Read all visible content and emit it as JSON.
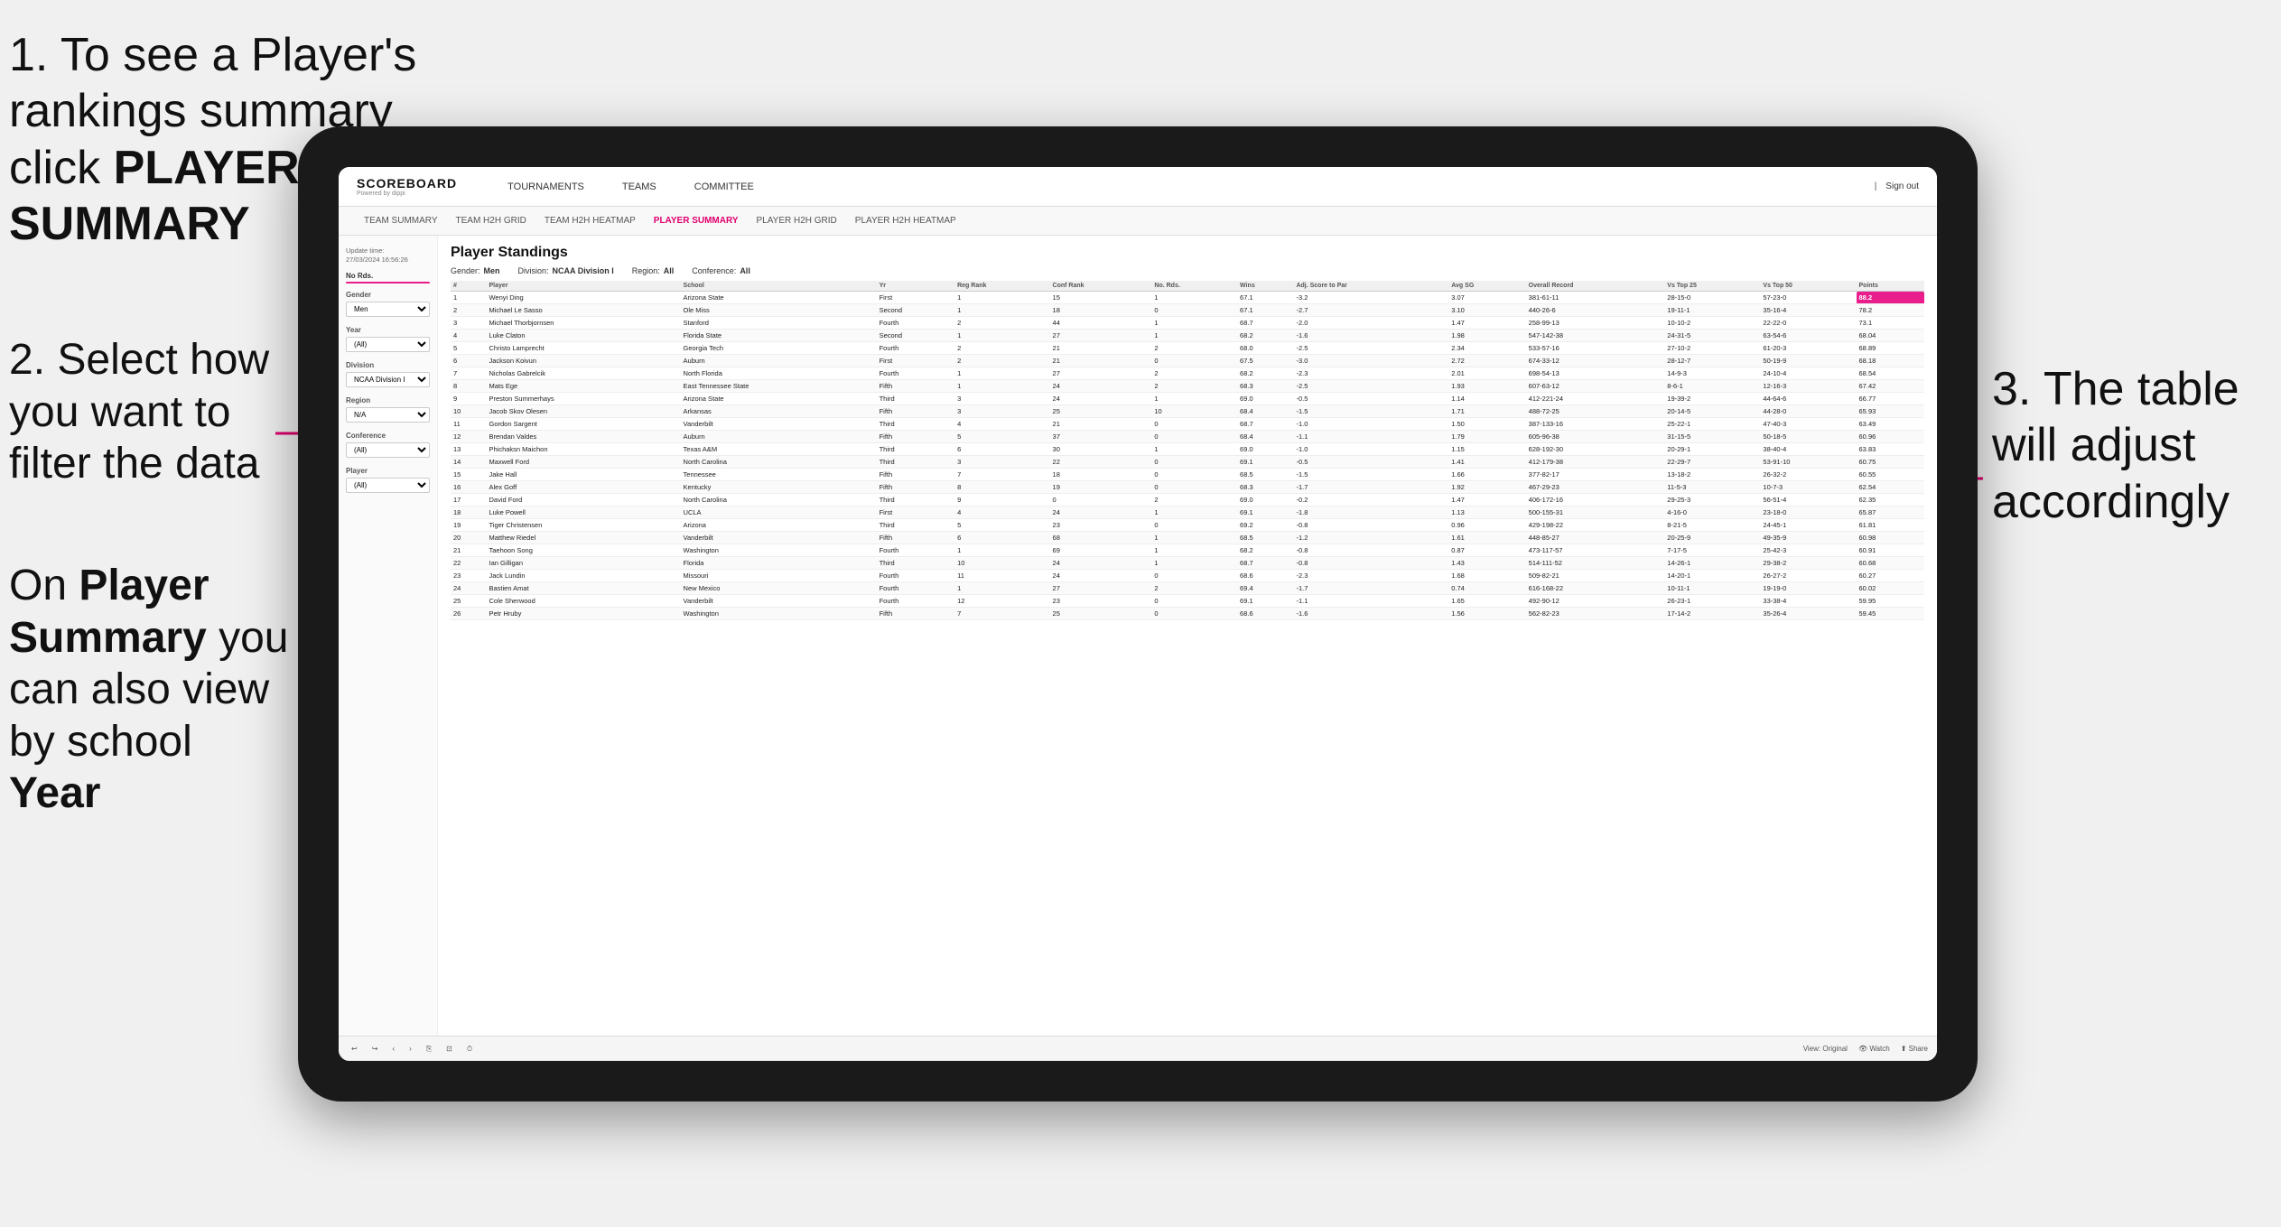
{
  "instructions": {
    "step1": "1. To see a Player's rankings summary click ",
    "step1_bold": "PLAYER SUMMARY",
    "step2_title": "2. Select how you want to filter the data",
    "step3_bottom": "On ",
    "step3_bold1": "Player Summary",
    "step3_mid": " you can also view by school ",
    "step3_bold2": "Year",
    "step3_right": "3. The table will adjust accordingly"
  },
  "nav": {
    "logo": "SCOREBOARD",
    "logo_sub": "Powered by dippi",
    "links": [
      "TOURNAMENTS",
      "TEAMS",
      "COMMITTEE"
    ],
    "sign_in": "Sign out"
  },
  "subnav": {
    "links": [
      "TEAM SUMMARY",
      "TEAM H2H GRID",
      "TEAM H2H HEATMAP",
      "PLAYER SUMMARY",
      "PLAYER H2H GRID",
      "PLAYER H2H HEATMAP"
    ],
    "active": "PLAYER SUMMARY"
  },
  "sidebar": {
    "update_label": "Update time:",
    "update_time": "27/03/2024 16:56:26",
    "no_rds_label": "No Rds.",
    "gender_label": "Gender",
    "gender_value": "Men",
    "year_label": "Year",
    "year_value": "(All)",
    "division_label": "Division",
    "division_value": "NCAA Division I",
    "region_label": "Region",
    "region_value": "N/A",
    "conference_label": "Conference",
    "conference_value": "(All)",
    "player_label": "Player",
    "player_value": "(All)"
  },
  "table": {
    "title": "Player Standings",
    "filters": {
      "gender_label": "Gender:",
      "gender_value": "Men",
      "division_label": "Division:",
      "division_value": "NCAA Division I",
      "region_label": "Region:",
      "region_value": "All",
      "conference_label": "Conference:",
      "conference_value": "All"
    },
    "columns": [
      "#",
      "Player",
      "School",
      "Yr",
      "Reg Rank",
      "Conf Rank",
      "No. Rds.",
      "Wins",
      "Adj. Score to Par",
      "Avg SG",
      "Overall Record",
      "Vs Top 25",
      "Vs Top 50",
      "Points"
    ],
    "rows": [
      {
        "num": "1",
        "player": "Wenyi Ding",
        "school": "Arizona State",
        "yr": "First",
        "reg_rank": "1",
        "conf_rank": "15",
        "rds": "1",
        "wins": "67.1",
        "adj": "-3.2",
        "sg": "3.07",
        "record": "381-61-11",
        "top25": "28-15-0",
        "top50": "57-23-0",
        "points": "88.2"
      },
      {
        "num": "2",
        "player": "Michael Le Sasso",
        "school": "Ole Miss",
        "yr": "Second",
        "reg_rank": "1",
        "conf_rank": "18",
        "rds": "0",
        "wins": "67.1",
        "adj": "-2.7",
        "sg": "3.10",
        "record": "440-26-6",
        "top25": "19-11-1",
        "top50": "35-16-4",
        "points": "78.2"
      },
      {
        "num": "3",
        "player": "Michael Thorbjornsen",
        "school": "Stanford",
        "yr": "Fourth",
        "reg_rank": "2",
        "conf_rank": "44",
        "rds": "1",
        "wins": "68.7",
        "adj": "-2.0",
        "sg": "1.47",
        "record": "258-99-13",
        "top25": "10-10-2",
        "top50": "22-22-0",
        "points": "73.1"
      },
      {
        "num": "4",
        "player": "Luke Claton",
        "school": "Florida State",
        "yr": "Second",
        "reg_rank": "1",
        "conf_rank": "27",
        "rds": "1",
        "wins": "68.2",
        "adj": "-1.6",
        "sg": "1.98",
        "record": "547-142-38",
        "top25": "24-31-5",
        "top50": "63-54-6",
        "points": "68.04"
      },
      {
        "num": "5",
        "player": "Christo Lamprecht",
        "school": "Georgia Tech",
        "yr": "Fourth",
        "reg_rank": "2",
        "conf_rank": "21",
        "rds": "2",
        "wins": "68.0",
        "adj": "-2.5",
        "sg": "2.34",
        "record": "533-57-16",
        "top25": "27-10-2",
        "top50": "61-20-3",
        "points": "68.89"
      },
      {
        "num": "6",
        "player": "Jackson Koivun",
        "school": "Auburn",
        "yr": "First",
        "reg_rank": "2",
        "conf_rank": "21",
        "rds": "0",
        "wins": "67.5",
        "adj": "-3.0",
        "sg": "2.72",
        "record": "674-33-12",
        "top25": "28-12-7",
        "top50": "50-19-9",
        "points": "68.18"
      },
      {
        "num": "7",
        "player": "Nicholas Gabrelcik",
        "school": "North Florida",
        "yr": "Fourth",
        "reg_rank": "1",
        "conf_rank": "27",
        "rds": "2",
        "wins": "68.2",
        "adj": "-2.3",
        "sg": "2.01",
        "record": "698-54-13",
        "top25": "14-9-3",
        "top50": "24-10-4",
        "points": "68.54"
      },
      {
        "num": "8",
        "player": "Mats Ege",
        "school": "East Tennessee State",
        "yr": "Fifth",
        "reg_rank": "1",
        "conf_rank": "24",
        "rds": "2",
        "wins": "68.3",
        "adj": "-2.5",
        "sg": "1.93",
        "record": "607-63-12",
        "top25": "8-6-1",
        "top50": "12-16-3",
        "points": "67.42"
      },
      {
        "num": "9",
        "player": "Preston Summerhays",
        "school": "Arizona State",
        "yr": "Third",
        "reg_rank": "3",
        "conf_rank": "24",
        "rds": "1",
        "wins": "69.0",
        "adj": "-0.5",
        "sg": "1.14",
        "record": "412-221-24",
        "top25": "19-39-2",
        "top50": "44-64-6",
        "points": "66.77"
      },
      {
        "num": "10",
        "player": "Jacob Skov Olesen",
        "school": "Arkansas",
        "yr": "Fifth",
        "reg_rank": "3",
        "conf_rank": "25",
        "rds": "10",
        "wins": "68.4",
        "adj": "-1.5",
        "sg": "1.71",
        "record": "488-72-25",
        "top25": "20-14-5",
        "top50": "44-28-0",
        "points": "65.93"
      },
      {
        "num": "11",
        "player": "Gordon Sargent",
        "school": "Vanderbilt",
        "yr": "Third",
        "reg_rank": "4",
        "conf_rank": "21",
        "rds": "0",
        "wins": "68.7",
        "adj": "-1.0",
        "sg": "1.50",
        "record": "387-133-16",
        "top25": "25-22-1",
        "top50": "47-40-3",
        "points": "63.49"
      },
      {
        "num": "12",
        "player": "Brendan Valdes",
        "school": "Auburn",
        "yr": "Fifth",
        "reg_rank": "5",
        "conf_rank": "37",
        "rds": "0",
        "wins": "68.4",
        "adj": "-1.1",
        "sg": "1.79",
        "record": "605-96-38",
        "top25": "31-15-5",
        "top50": "50-18-5",
        "points": "60.96"
      },
      {
        "num": "13",
        "player": "Phichaksn Maichon",
        "school": "Texas A&M",
        "yr": "Third",
        "reg_rank": "6",
        "conf_rank": "30",
        "rds": "1",
        "wins": "69.0",
        "adj": "-1.0",
        "sg": "1.15",
        "record": "628-192-30",
        "top25": "20-29-1",
        "top50": "38-40-4",
        "points": "63.83"
      },
      {
        "num": "14",
        "player": "Maxwell Ford",
        "school": "North Carolina",
        "yr": "Third",
        "reg_rank": "3",
        "conf_rank": "22",
        "rds": "0",
        "wins": "69.1",
        "adj": "-0.5",
        "sg": "1.41",
        "record": "412-179-38",
        "top25": "22-29-7",
        "top50": "53-91-10",
        "points": "60.75"
      },
      {
        "num": "15",
        "player": "Jake Hall",
        "school": "Tennessee",
        "yr": "Fifth",
        "reg_rank": "7",
        "conf_rank": "18",
        "rds": "0",
        "wins": "68.5",
        "adj": "-1.5",
        "sg": "1.66",
        "record": "377-82-17",
        "top25": "13-18-2",
        "top50": "26-32-2",
        "points": "60.55"
      },
      {
        "num": "16",
        "player": "Alex Goff",
        "school": "Kentucky",
        "yr": "Fifth",
        "reg_rank": "8",
        "conf_rank": "19",
        "rds": "0",
        "wins": "68.3",
        "adj": "-1.7",
        "sg": "1.92",
        "record": "467-29-23",
        "top25": "11-5-3",
        "top50": "10-7-3",
        "points": "62.54"
      },
      {
        "num": "17",
        "player": "David Ford",
        "school": "North Carolina",
        "yr": "Third",
        "reg_rank": "9",
        "conf_rank": "0",
        "rds": "2",
        "wins": "69.0",
        "adj": "-0.2",
        "sg": "1.47",
        "record": "406-172-16",
        "top25": "29-25-3",
        "top50": "56-51-4",
        "points": "62.35"
      },
      {
        "num": "18",
        "player": "Luke Powell",
        "school": "UCLA",
        "yr": "First",
        "reg_rank": "4",
        "conf_rank": "24",
        "rds": "1",
        "wins": "69.1",
        "adj": "-1.8",
        "sg": "1.13",
        "record": "500-155-31",
        "top25": "4-16-0",
        "top50": "23-18-0",
        "points": "65.87"
      },
      {
        "num": "19",
        "player": "Tiger Christensen",
        "school": "Arizona",
        "yr": "Third",
        "reg_rank": "5",
        "conf_rank": "23",
        "rds": "0",
        "wins": "69.2",
        "adj": "-0.8",
        "sg": "0.96",
        "record": "429-198-22",
        "top25": "8-21-5",
        "top50": "24-45-1",
        "points": "61.81"
      },
      {
        "num": "20",
        "player": "Matthew Riedel",
        "school": "Vanderbilt",
        "yr": "Fifth",
        "reg_rank": "6",
        "conf_rank": "68",
        "rds": "1",
        "wins": "68.5",
        "adj": "-1.2",
        "sg": "1.61",
        "record": "448-85-27",
        "top25": "20-25-9",
        "top50": "49-35-9",
        "points": "60.98"
      },
      {
        "num": "21",
        "player": "Taehoon Song",
        "school": "Washington",
        "yr": "Fourth",
        "reg_rank": "1",
        "conf_rank": "69",
        "rds": "1",
        "wins": "68.2",
        "adj": "-0.8",
        "sg": "0.87",
        "record": "473-117-57",
        "top25": "7-17-5",
        "top50": "25-42-3",
        "points": "60.91"
      },
      {
        "num": "22",
        "player": "Ian Gilligan",
        "school": "Florida",
        "yr": "Third",
        "reg_rank": "10",
        "conf_rank": "24",
        "rds": "1",
        "wins": "68.7",
        "adj": "-0.8",
        "sg": "1.43",
        "record": "514-111-52",
        "top25": "14-26-1",
        "top50": "29-38-2",
        "points": "60.68"
      },
      {
        "num": "23",
        "player": "Jack Lundin",
        "school": "Missouri",
        "yr": "Fourth",
        "reg_rank": "11",
        "conf_rank": "24",
        "rds": "0",
        "wins": "68.6",
        "adj": "-2.3",
        "sg": "1.68",
        "record": "509-82-21",
        "top25": "14-20-1",
        "top50": "26-27-2",
        "points": "60.27"
      },
      {
        "num": "24",
        "player": "Bastien Amat",
        "school": "New Mexico",
        "yr": "Fourth",
        "reg_rank": "1",
        "conf_rank": "27",
        "rds": "2",
        "wins": "69.4",
        "adj": "-1.7",
        "sg": "0.74",
        "record": "616-168-22",
        "top25": "10-11-1",
        "top50": "19-19-0",
        "points": "60.02"
      },
      {
        "num": "25",
        "player": "Cole Sherwood",
        "school": "Vanderbilt",
        "yr": "Fourth",
        "reg_rank": "12",
        "conf_rank": "23",
        "rds": "0",
        "wins": "69.1",
        "adj": "-1.1",
        "sg": "1.65",
        "record": "492-90-12",
        "top25": "26-23-1",
        "top50": "33-38-4",
        "points": "59.95"
      },
      {
        "num": "26",
        "player": "Petr Hruby",
        "school": "Washington",
        "yr": "Fifth",
        "reg_rank": "7",
        "conf_rank": "25",
        "rds": "0",
        "wins": "68.6",
        "adj": "-1.6",
        "sg": "1.56",
        "record": "562-82-23",
        "top25": "17-14-2",
        "top50": "35-26-4",
        "points": "59.45"
      }
    ]
  },
  "toolbar": {
    "view_label": "View: Original",
    "watch_label": "Watch",
    "share_label": "Share"
  }
}
